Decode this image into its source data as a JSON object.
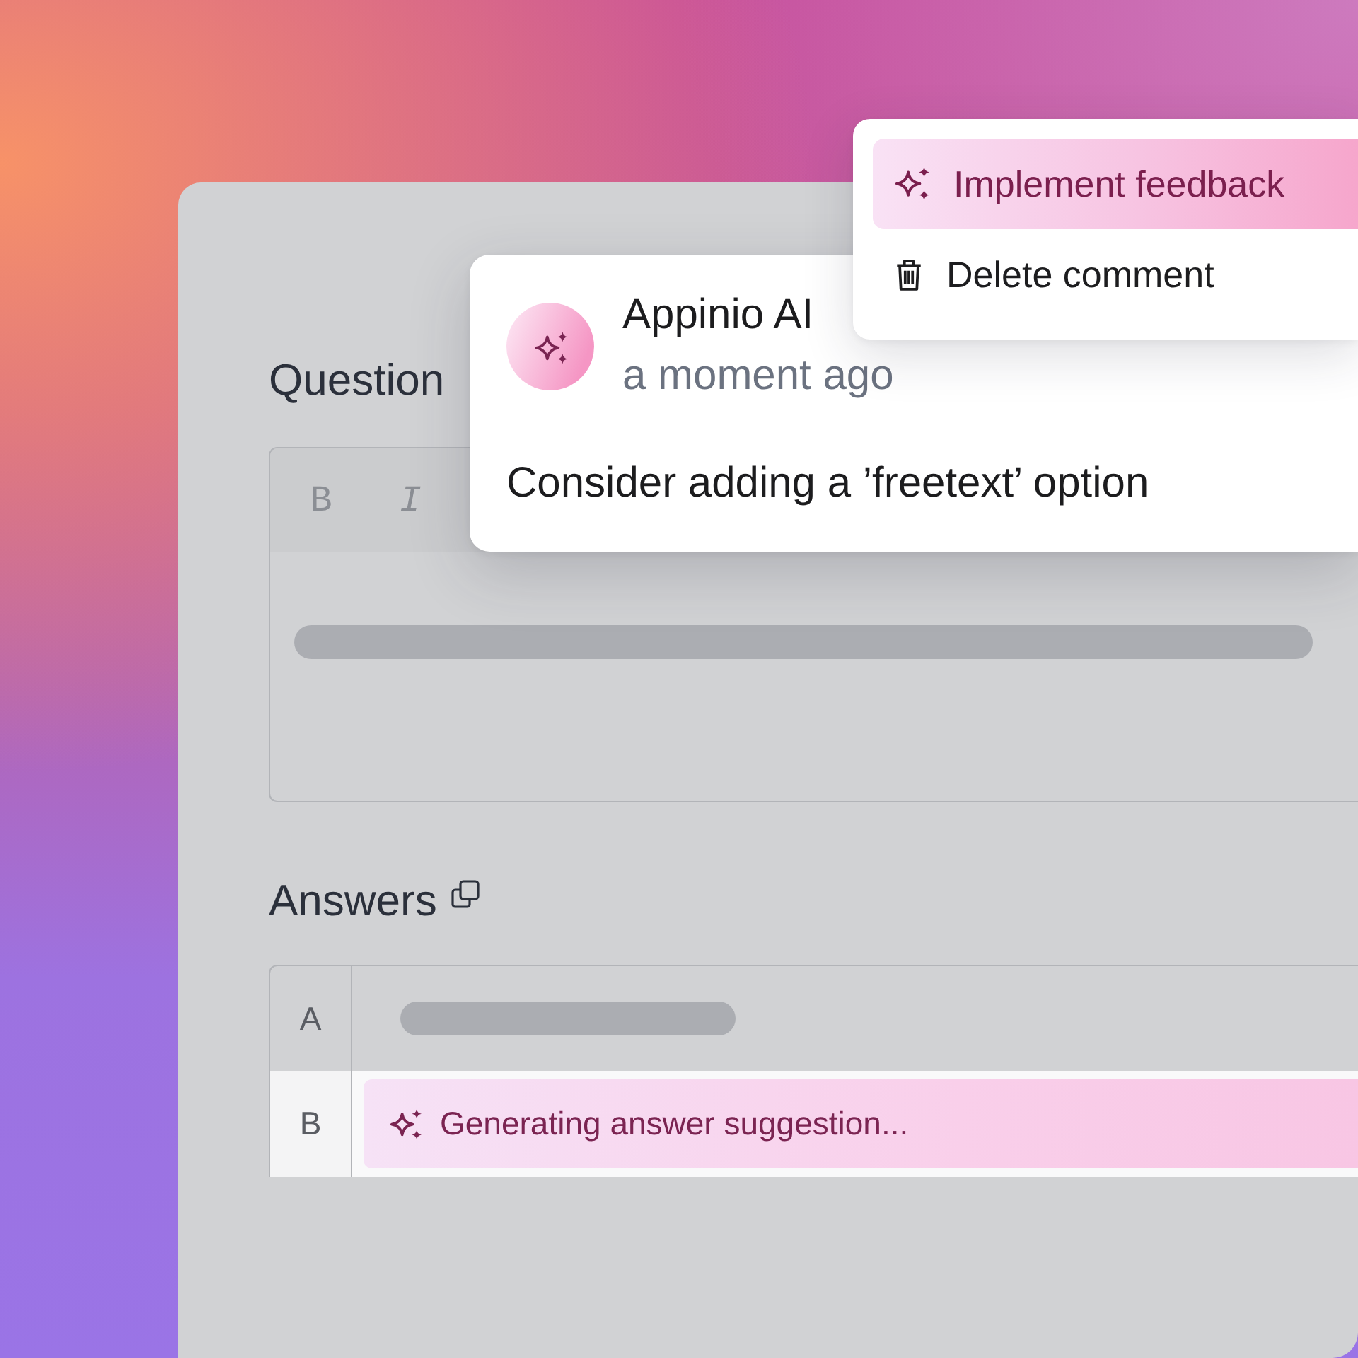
{
  "menu": {
    "items": [
      {
        "kind": "ai",
        "label": "Implement feedback",
        "selected": true
      },
      {
        "kind": "delete",
        "label": "Delete comment",
        "selected": false
      }
    ]
  },
  "comment": {
    "author": "Appinio AI",
    "time": "a moment ago",
    "text": "Consider adding a ’freetext’ option"
  },
  "question": {
    "label": "Question",
    "toolbar": [
      {
        "kind": "bold",
        "label": "B"
      },
      {
        "kind": "italic",
        "label": "I"
      }
    ]
  },
  "answers": {
    "label": "Answers",
    "rows": [
      {
        "letter": "A",
        "kind": "loading"
      },
      {
        "letter": "B",
        "kind": "generating",
        "text": "Generating answer suggestion..."
      }
    ]
  }
}
